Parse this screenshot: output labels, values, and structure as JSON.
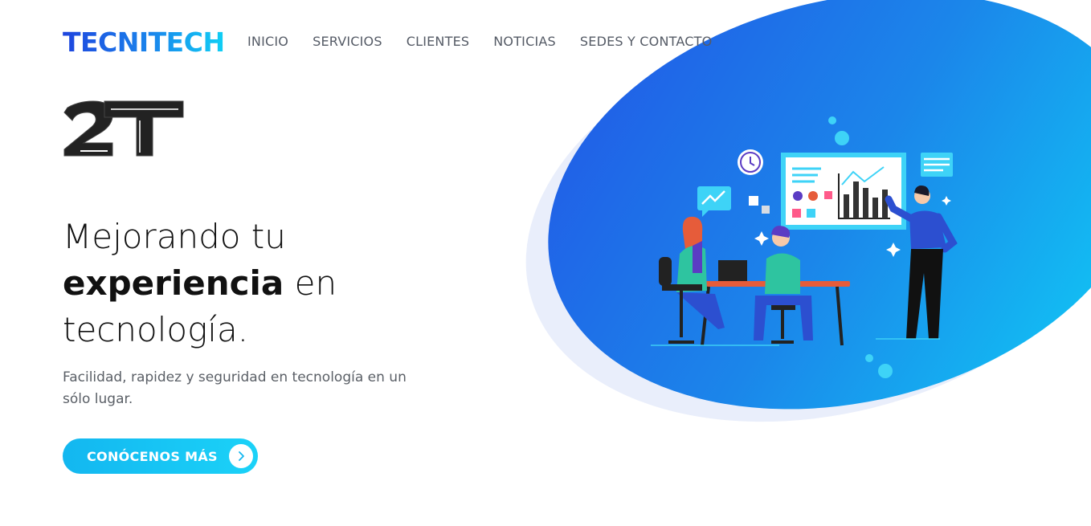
{
  "brand": {
    "name": "TECNITECH"
  },
  "nav": {
    "items": [
      {
        "label": "INICIO"
      },
      {
        "label": "SERVICIOS"
      },
      {
        "label": "CLIENTES"
      },
      {
        "label": "NOTICIAS"
      },
      {
        "label": "SEDES Y CONTACTO"
      }
    ]
  },
  "hero": {
    "mark_text": "2T",
    "headline": {
      "line1": "Mejorando tu",
      "line2_bold": "experiencia",
      "line2_rest": " en",
      "line3": "tecnología."
    },
    "subtitle": "Facilidad, rapidez y seguridad en tecnología en un sólo lugar.",
    "cta": {
      "label": "CONÓCENOS MÁS",
      "icon": "chevron-right-icon"
    },
    "illustration": "team-working-illustration"
  },
  "colors": {
    "brand_blue": "#1e45de",
    "brand_cyan": "#0fd0f5",
    "cta": "#13b7f0",
    "nav_text": "#555b66"
  }
}
